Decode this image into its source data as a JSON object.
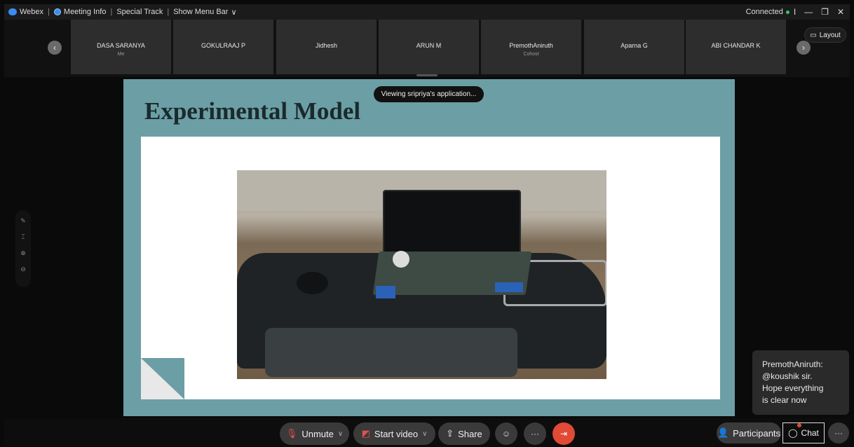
{
  "titlebar": {
    "app_name": "Webex",
    "meeting_info": "Meeting Info",
    "special_track": "Special Track",
    "show_menu_bar": "Show Menu Bar",
    "chevron": "∨",
    "status": "Connected",
    "status_color": "#39c46a",
    "win_controls": [
      "I",
      "—",
      "❐",
      "✕"
    ]
  },
  "participants_strip": {
    "prev_icon": "chevron-left-icon",
    "next_icon": "chevron-right-icon",
    "tiles": [
      {
        "name": "DASA SARANYA",
        "sub": "Me"
      },
      {
        "name": "GOKULRAAJ P",
        "sub": ""
      },
      {
        "name": "Jidhesh",
        "sub": ""
      },
      {
        "name": "ARUN M",
        "sub": ""
      },
      {
        "name": "PremothAniruth",
        "sub": "Cohost"
      },
      {
        "name": "Aparna G",
        "sub": ""
      },
      {
        "name": "ABI CHANDAR K",
        "sub": ""
      }
    ]
  },
  "layout_button": {
    "label": "Layout"
  },
  "share_tooltip": "Viewing sripriya's application...",
  "slide": {
    "title": "Experimental Model",
    "background": "#6c9ea5"
  },
  "chat_popup": {
    "text": "PremothAniruth:\n@koushik sir.\nHope everything\nis clear now"
  },
  "controls": {
    "unmute": "Unmute",
    "start_video": "Start video",
    "share": "Share",
    "participants": "Participants",
    "chat": "Chat",
    "more": "···",
    "leave_color": "#e04a36"
  }
}
